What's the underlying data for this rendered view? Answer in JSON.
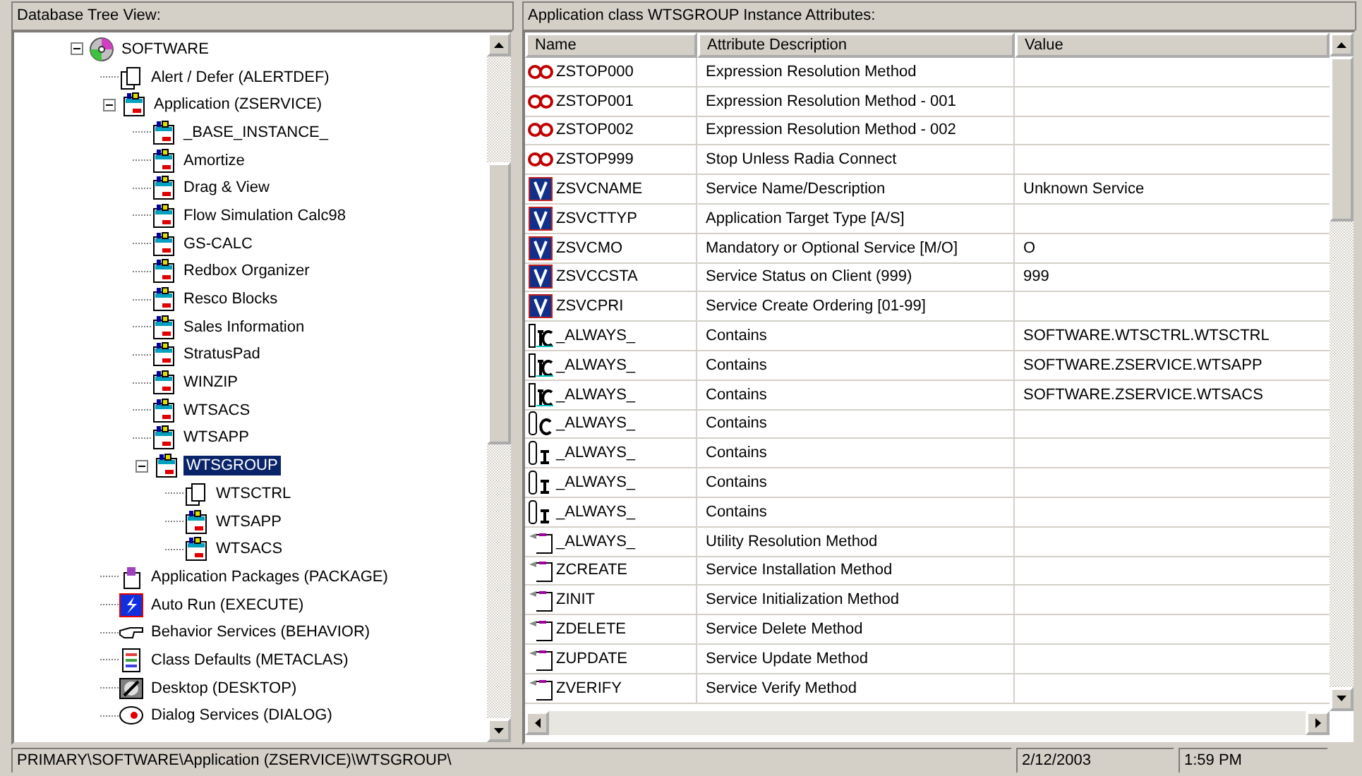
{
  "tree_panel": {
    "title": "Database Tree View:",
    "tree": [
      {
        "label": "SOFTWARE",
        "kind": "disc",
        "selected": false,
        "expanded": true,
        "children": [
          {
            "label": "Alert / Defer (ALERTDEF)",
            "kind": "doc",
            "selected": false
          },
          {
            "label": "Application (ZSERVICE)",
            "kind": "app",
            "selected": false,
            "expanded": true,
            "children": [
              {
                "label": "_BASE_INSTANCE_",
                "kind": "app",
                "selected": false
              },
              {
                "label": "Amortize",
                "kind": "app",
                "selected": false
              },
              {
                "label": "Drag & View",
                "kind": "app",
                "selected": false
              },
              {
                "label": "Flow Simulation Calc98",
                "kind": "app",
                "selected": false
              },
              {
                "label": "GS-CALC",
                "kind": "app",
                "selected": false
              },
              {
                "label": "Redbox Organizer",
                "kind": "app",
                "selected": false
              },
              {
                "label": "Resco Blocks",
                "kind": "app",
                "selected": false
              },
              {
                "label": "Sales Information",
                "kind": "app",
                "selected": false
              },
              {
                "label": "StratusPad",
                "kind": "app",
                "selected": false
              },
              {
                "label": "WINZIP",
                "kind": "app",
                "selected": false
              },
              {
                "label": "WTSACS",
                "kind": "app",
                "selected": false
              },
              {
                "label": "WTSAPP",
                "kind": "app",
                "selected": false
              },
              {
                "label": "WTSGROUP",
                "kind": "app",
                "selected": true,
                "expanded": true,
                "children": [
                  {
                    "label": "WTSCTRL",
                    "kind": "doc",
                    "selected": false
                  },
                  {
                    "label": "WTSAPP",
                    "kind": "app",
                    "selected": false
                  },
                  {
                    "label": "WTSACS",
                    "kind": "app",
                    "selected": false
                  }
                ]
              }
            ]
          },
          {
            "label": "Application Packages (PACKAGE)",
            "kind": "package",
            "selected": false
          },
          {
            "label": "Auto Run (EXECUTE)",
            "kind": "autorun",
            "selected": false
          },
          {
            "label": "Behavior Services (BEHAVIOR)",
            "kind": "behavior",
            "selected": false
          },
          {
            "label": "Class Defaults (METACLAS)",
            "kind": "list",
            "selected": false
          },
          {
            "label": "Desktop (DESKTOP)",
            "kind": "desktop",
            "selected": false
          },
          {
            "label": "Dialog Services (DIALOG)",
            "kind": "dialog",
            "selected": false
          }
        ]
      }
    ]
  },
  "attributes_panel": {
    "title": "Application class WTSGROUP Instance Attributes:",
    "columns": [
      "Name",
      "Attribute Description",
      "Value"
    ],
    "rows": [
      {
        "kind": "stop",
        "name": "ZSTOP000",
        "description": "Expression Resolution Method"
      },
      {
        "kind": "stop",
        "name": "ZSTOP001",
        "description": "Expression Resolution Method - 001"
      },
      {
        "kind": "stop",
        "name": "ZSTOP002",
        "description": "Expression Resolution Method - 002"
      },
      {
        "kind": "stop",
        "name": "ZSTOP999",
        "description": "Stop Unless Radia Connect"
      },
      {
        "kind": "variable",
        "name": "ZSVCNAME",
        "description": "Service Name/Description",
        "value": "Unknown Service"
      },
      {
        "kind": "variable",
        "name": "ZSVCTTYP",
        "description": "Application Target Type [A/S]"
      },
      {
        "kind": "variable",
        "name": "ZSVCMO",
        "description": "Mandatory or Optional Service [M/O]",
        "value": "O"
      },
      {
        "kind": "variable",
        "name": "ZSVCCSTA",
        "description": "Service Status on Client (999)",
        "value": "999"
      },
      {
        "kind": "variable",
        "name": "ZSVCPRI",
        "description": "Service Create Ordering [01-99]"
      },
      {
        "kind": "contains-tc",
        "name": "_ALWAYS_",
        "description": "Contains",
        "value": "SOFTWARE.WTSCTRL.WTSCTRL"
      },
      {
        "kind": "contains-tc",
        "name": "_ALWAYS_",
        "description": "Contains",
        "value": "SOFTWARE.ZSERVICE.WTSAPP"
      },
      {
        "kind": "contains-tc",
        "name": "_ALWAYS_",
        "description": "Contains",
        "value": "SOFTWARE.ZSERVICE.WTSACS"
      },
      {
        "kind": "contains-c",
        "name": "_ALWAYS_",
        "description": "Contains"
      },
      {
        "kind": "contains-i",
        "name": "_ALWAYS_",
        "description": "Contains"
      },
      {
        "kind": "contains-i",
        "name": "_ALWAYS_",
        "description": "Contains"
      },
      {
        "kind": "contains-i",
        "name": "_ALWAYS_",
        "description": "Contains"
      },
      {
        "kind": "method",
        "name": "_ALWAYS_",
        "description": "Utility Resolution Method"
      },
      {
        "kind": "method",
        "name": "ZCREATE",
        "description": "Service Installation Method"
      },
      {
        "kind": "method",
        "name": "ZINIT",
        "description": "Service Initialization Method"
      },
      {
        "kind": "method",
        "name": "ZDELETE",
        "description": "Service Delete Method"
      },
      {
        "kind": "method",
        "name": "ZUPDATE",
        "description": "Service Update Method"
      },
      {
        "kind": "method",
        "name": "ZVERIFY",
        "description": "Service Verify Method"
      }
    ]
  },
  "status_bar": {
    "path": "PRIMARY\\SOFTWARE\\Application (ZSERVICE)\\WTSGROUP\\",
    "date": "2/12/2003",
    "time": "1:59 PM"
  }
}
